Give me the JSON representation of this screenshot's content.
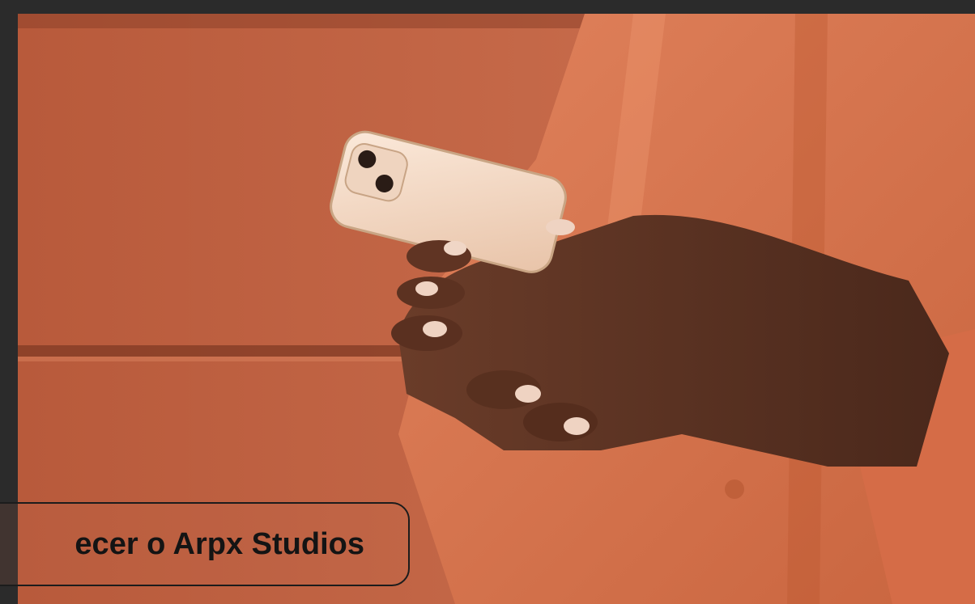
{
  "hero": {
    "image_subject": "hand-holding-smartphone-photo"
  },
  "cta": {
    "label": "ecer o Arpx Studios"
  },
  "colors": {
    "frame": "#2b2b2b",
    "wall": "#c86a48",
    "shirt": "#d9744f",
    "skin": "#5a3324",
    "phone": "#f1d9c6",
    "button_border": "#1c1c1c",
    "button_text": "#141414"
  }
}
